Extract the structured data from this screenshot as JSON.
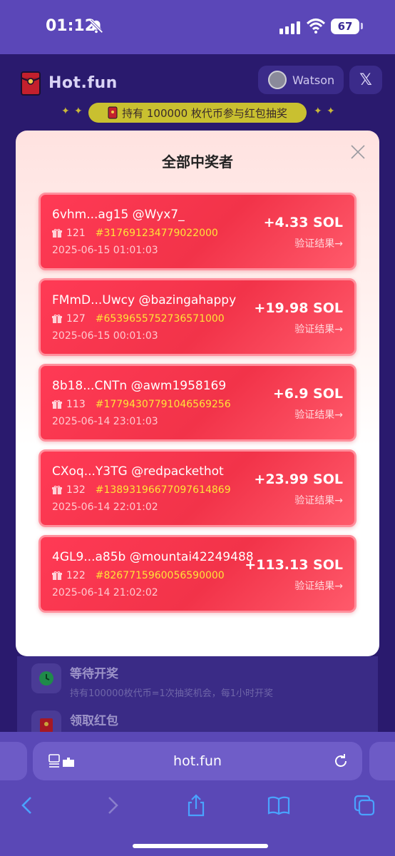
{
  "status_bar": {
    "time": "01:12",
    "battery": "67"
  },
  "header": {
    "brand": "Hot.fun",
    "user": "Watson",
    "x_label": "𝕏"
  },
  "banner": {
    "text": "持有 100000 枚代币参与红包抽奖"
  },
  "background_items": [
    {
      "title": "等待开奖",
      "subtitle": "持有100000枚代币=1次抽奖机会，每1小时开奖"
    },
    {
      "title": "领取红包",
      "subtitle": ""
    }
  ],
  "modal": {
    "title": "全部中奖者",
    "winners": [
      {
        "name": "6vhm...ag15 @Wyx7_",
        "count": "121",
        "hash": "#317691234779022000",
        "date": "2025-06-15 01:01:03",
        "amount": "+4.33 SOL",
        "verify": "验证结果→"
      },
      {
        "name": "FMmD...Uwcy @bazingahappy",
        "count": "127",
        "hash": "#6539655752736571000",
        "date": "2025-06-15 00:01:03",
        "amount": "+19.98 SOL",
        "verify": "验证结果→"
      },
      {
        "name": "8b18...CNTn @awm1958169",
        "count": "113",
        "hash": "#17794307791046569256",
        "date": "2025-06-14 23:01:03",
        "amount": "+6.9 SOL",
        "verify": "验证结果→"
      },
      {
        "name": "CXoq...Y3TG @redpackethot",
        "count": "132",
        "hash": "#13893196677097614869",
        "date": "2025-06-14 22:01:02",
        "amount": "+23.99 SOL",
        "verify": "验证结果→"
      },
      {
        "name": "4GL9...a85b @mountai42249488",
        "count": "122",
        "hash": "#8267715960056590000",
        "date": "2025-06-14 21:02:02",
        "amount": "+113.13 SOL",
        "verify": "验证结果→"
      }
    ]
  },
  "browser": {
    "url": "hot.fun"
  },
  "colors": {
    "accent": "#f23349",
    "hash": "#ffe438",
    "chrome": "#5a48b6"
  }
}
